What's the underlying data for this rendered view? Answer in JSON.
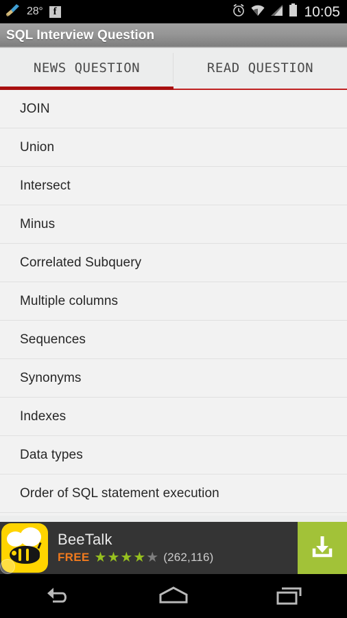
{
  "status_bar": {
    "temperature": "28°",
    "clock": "10:05",
    "left_icons": [
      "cleaner-broom-icon",
      "facebook-icon"
    ],
    "right_icons": [
      "alarm-clock-icon",
      "wifi-icon",
      "cellular-signal-icon",
      "battery-icon"
    ],
    "background_color": "#000000"
  },
  "title_bar": {
    "title": "SQL Interview Question"
  },
  "tabs": {
    "items": [
      {
        "label": "NEWS QUESTION",
        "active": true
      },
      {
        "label": "READ QUESTION",
        "active": false
      }
    ],
    "active_underline_color": "#a80f0f",
    "inactive_underline_color": "#bf2020"
  },
  "list": {
    "items": [
      {
        "label": "JOIN"
      },
      {
        "label": "Union"
      },
      {
        "label": "Intersect"
      },
      {
        "label": "Minus"
      },
      {
        "label": "Correlated Subquery"
      },
      {
        "label": "Multiple columns"
      },
      {
        "label": "Sequences"
      },
      {
        "label": "Synonyms"
      },
      {
        "label": "Indexes"
      },
      {
        "label": "Data types"
      },
      {
        "label": "Order of SQL statement execution"
      }
    ]
  },
  "ad": {
    "app_name": "BeeTalk",
    "price_label": "FREE",
    "rating": 4,
    "rating_max": 5,
    "rating_count": "(262,116)",
    "icon_name": "beetalk-bee-icon",
    "cta_icon": "download-icon",
    "cta_color": "#a2c238",
    "background_color": "#343434",
    "price_color": "#f07a1e",
    "star_on_color": "#97c11f",
    "star_off_color": "#7e7e7e",
    "star_glyph": "★",
    "adchoices_label": ""
  },
  "nav_bar": {
    "buttons": [
      {
        "name": "back-button"
      },
      {
        "name": "home-button"
      },
      {
        "name": "recents-button"
      }
    ]
  }
}
